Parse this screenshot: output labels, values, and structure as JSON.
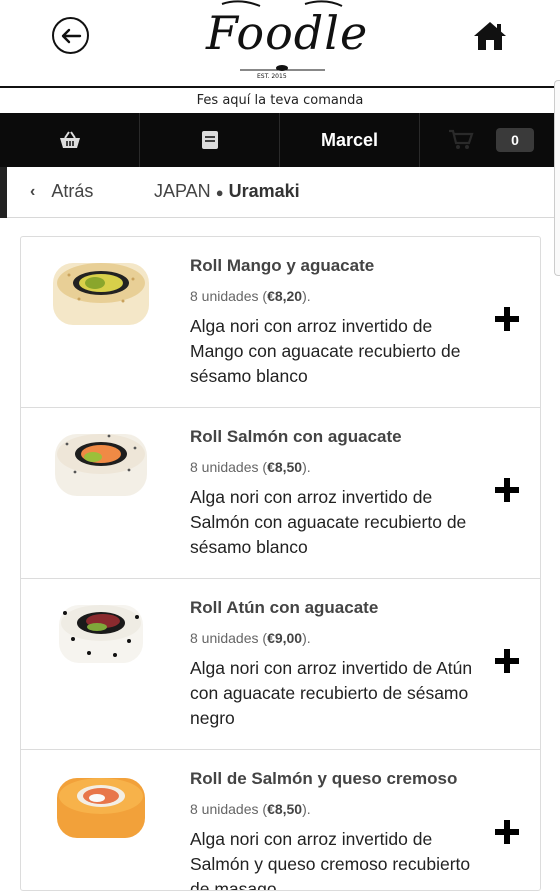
{
  "app": {
    "logo_text": "Foodle",
    "logo_est": "EST. 2015",
    "subtitle": "Fes aquí la teva comanda"
  },
  "nav": {
    "user_name": "Marcel",
    "cart_count": "0",
    "icons": [
      "basket-icon",
      "menu-book-icon",
      "cart-icon"
    ]
  },
  "breadcrumb": {
    "back_label": "Atrás",
    "category": "JAPAN",
    "separator": "●",
    "subcategory": "Uramaki"
  },
  "products": [
    {
      "name": "Roll Mango y aguacate",
      "units_prefix": "8 unidades (",
      "price": "€8,20",
      "units_suffix": ").",
      "description": "Alga nori con arroz invertido de Mango con aguacate recubierto de sésamo blanco",
      "image": "roll-mango-aguacate"
    },
    {
      "name": "Roll Salmón con aguacate",
      "units_prefix": "8 unidades (",
      "price": "€8,50",
      "units_suffix": ").",
      "description": "Alga nori con arroz invertido de Salmón con aguacate recubierto de sésamo blanco",
      "image": "roll-salmon-aguacate"
    },
    {
      "name": "Roll Atún con aguacate",
      "units_prefix": "8 unidades (",
      "price": "€9,00",
      "units_suffix": ").",
      "description": "Alga nori con arroz invertido de Atún con aguacate recubierto de sésamo negro",
      "image": "roll-atun-aguacate"
    },
    {
      "name": "Roll de Salmón y queso cremoso",
      "units_prefix": "8 unidades (",
      "price": "€8,50",
      "units_suffix": ").",
      "description": "Alga nori con arroz invertido de Salmón y queso cremoso recubierto de masago",
      "image": "roll-salmon-queso"
    }
  ],
  "colors": {
    "navbar": "#0b0b0b",
    "accent_text": "#444444"
  }
}
